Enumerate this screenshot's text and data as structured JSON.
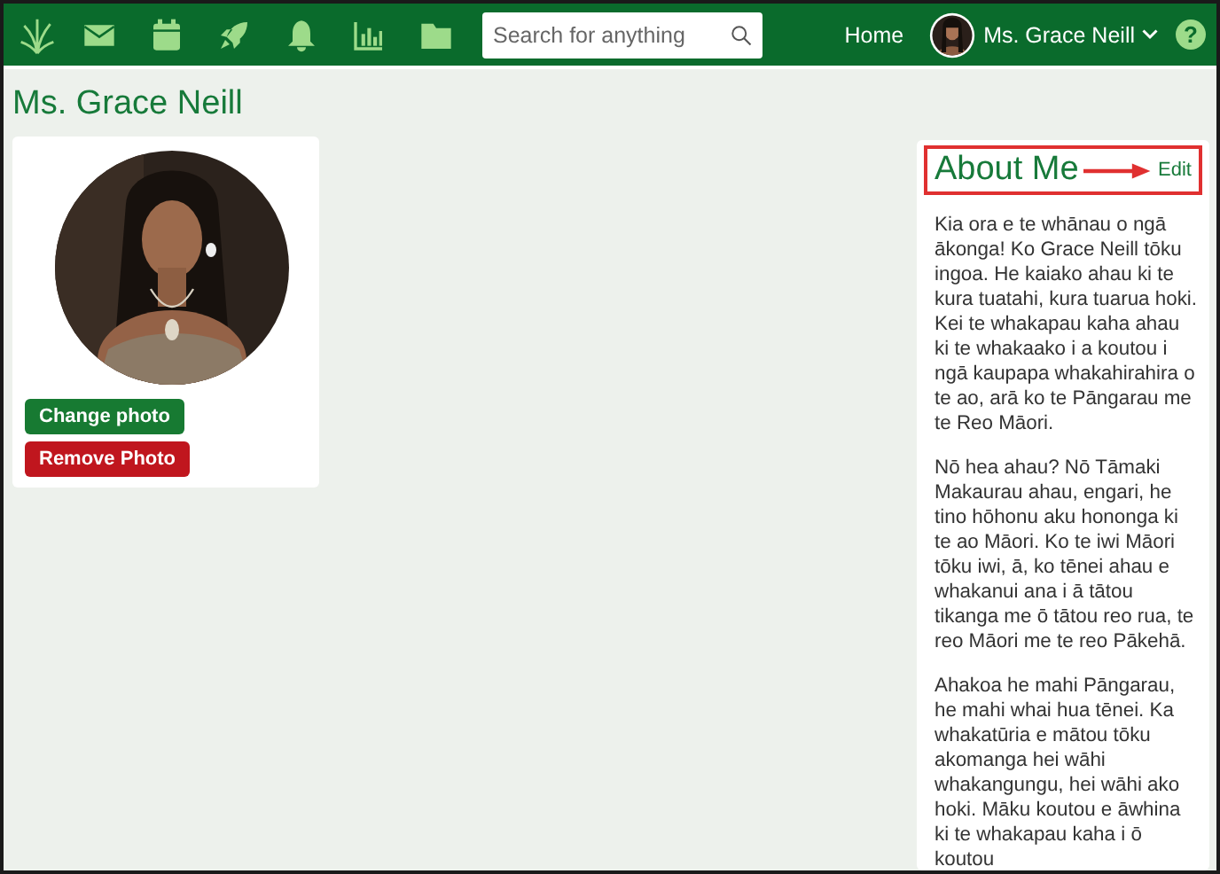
{
  "navbar": {
    "search": {
      "placeholder": "Search for anything"
    },
    "links": [
      "Home"
    ],
    "user": {
      "name": "Ms. Grace Neill"
    },
    "help": "?"
  },
  "page_title": "Ms. Grace Neill",
  "photo_card": {
    "buttons": [
      {
        "label": "Change photo",
        "kind": "primary"
      },
      {
        "label": "Remove Photo",
        "kind": "danger"
      }
    ]
  },
  "about": {
    "title": "About Me",
    "edit": "Edit",
    "highlighted": true,
    "paragraphs": [
      "Kia ora e te whānau o ngā ākonga! Ko Grace Neill tōku ingoa. He kaiako ahau ki te kura tuatahi, kura tuarua hoki. Kei te whakapau kaha ahau ki te whakaako i a koutou i ngā kaupapa whakahirahira o te ao, arā ko te Pāngarau me te Reo Māori.",
      "Nō hea ahau? Nō Tāmaki Makaurau ahau, engari, he tino hōhonu aku hononga ki te ao Māori. Ko te iwi Māori tōku iwi, ā, ko tēnei ahau e whakanui ana i ā tātou tikanga me ō tātou reo rua, te reo Māori me te reo Pākehā.",
      "Ahakoa he mahi Pāngarau, he mahi whai hua tēnei. Ka whakatūria e mātou tōku akomanga hei wāhi whakangungu, hei wāhi ako hoki. Māku koutou e āwhina ki te whakapau kaha i ō koutou"
    ]
  }
}
